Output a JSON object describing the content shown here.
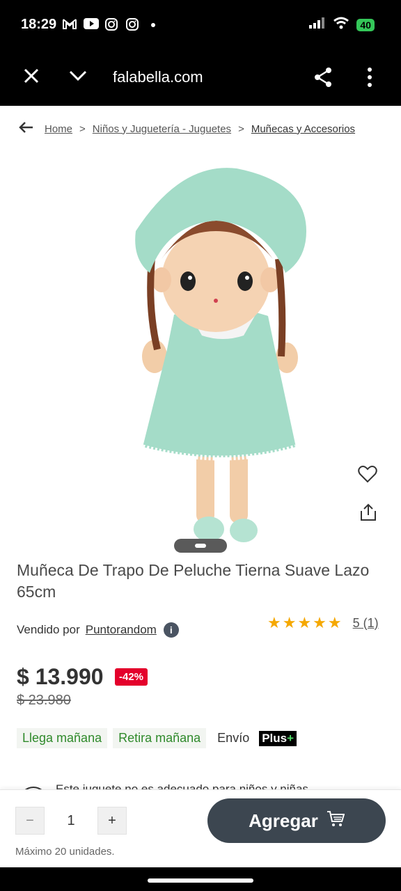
{
  "status_bar": {
    "time": "18:29",
    "battery": "40",
    "left_icons": [
      "gmail-icon",
      "youtube-icon",
      "instagram-icon",
      "instagram-icon",
      "dot-icon"
    ]
  },
  "browser": {
    "url": "falabella.com"
  },
  "breadcrumb": {
    "items": [
      "Home",
      "Niños y Juguetería - Juguetes",
      "Muñecas y Accesorios"
    ],
    "separator": ">"
  },
  "product": {
    "title": "Muñeca De Trapo De Peluche Tierna Suave Lazo 65cm",
    "seller_prefix": "Vendido por",
    "seller_name": "Puntorandom",
    "stars": "★★★★★",
    "rating_text": "5 (1)",
    "price": "$ 13.990",
    "discount": "-42%",
    "old_price": "$ 23.980",
    "delivery_chips": [
      "Llega mañana",
      "Retira mañana"
    ],
    "envio_label": "Envío",
    "plus_badge": "Plus",
    "plus_sign": "+",
    "warning_text": "Este juguete no es adecuado para niños y niñas"
  },
  "cart": {
    "minus": "−",
    "quantity": "1",
    "plus": "+",
    "max_text": "Máximo 20 unidades.",
    "add_label": "Agregar"
  },
  "colors": {
    "accent_green": "#2f8a2b",
    "discount_red": "#e4002b",
    "button_dark": "#3c4650",
    "star_gold": "#f5a800"
  }
}
